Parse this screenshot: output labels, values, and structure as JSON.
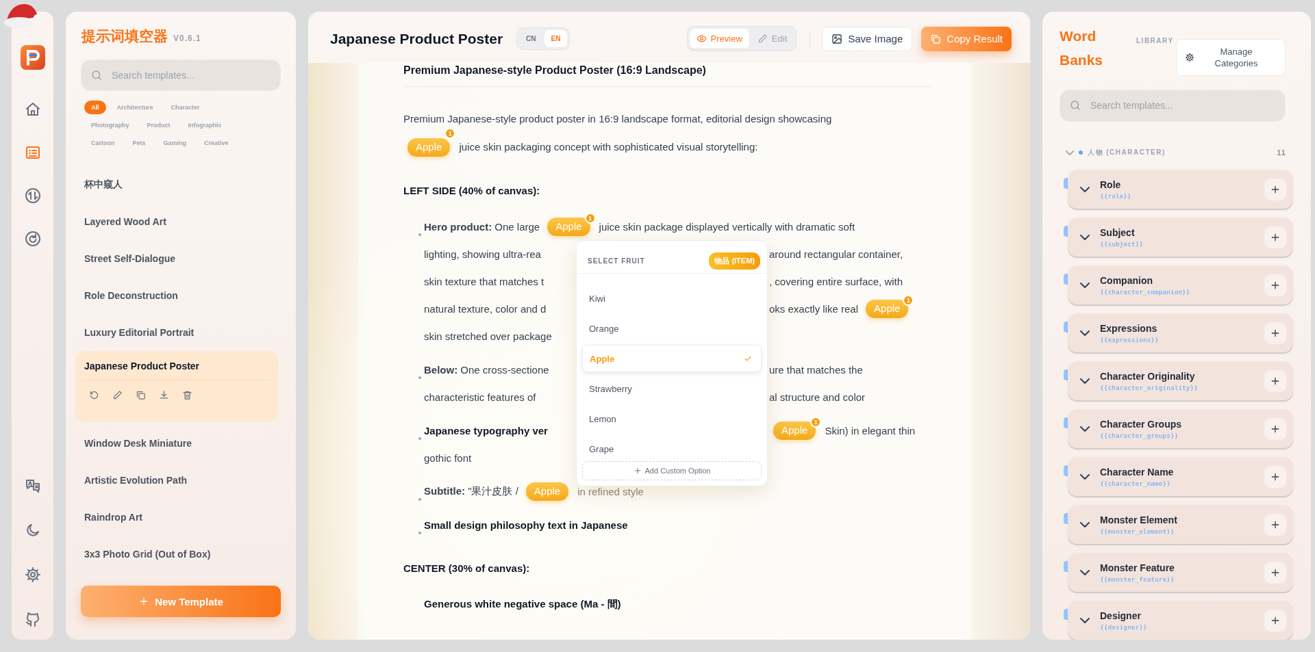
{
  "rail": {
    "items": [
      {
        "selected": false
      },
      {
        "selected": true
      },
      {
        "selected": false
      },
      {
        "selected": false
      }
    ]
  },
  "templates_panel": {
    "brand": "提示词填空器",
    "version": "V0.6.1",
    "search": {
      "placeholder": "Search templates..."
    },
    "filters": [
      {
        "label": "All",
        "selected": true
      },
      {
        "label": "Architecture",
        "selected": false
      },
      {
        "label": "Character",
        "selected": false
      },
      {
        "label": "Photography",
        "selected": false
      },
      {
        "label": "Product",
        "selected": false
      },
      {
        "label": "Infographic",
        "selected": false
      },
      {
        "label": "Cartoon",
        "selected": false
      },
      {
        "label": "Pets",
        "selected": false
      },
      {
        "label": "Gaming",
        "selected": false
      },
      {
        "label": "Creative",
        "selected": false
      }
    ],
    "templates": [
      {
        "title": "杯中窥人",
        "selected": false
      },
      {
        "title": "Layered Wood Art",
        "selected": false
      },
      {
        "title": "Street Self-Dialogue",
        "selected": false
      },
      {
        "title": "Role Deconstruction",
        "selected": false
      },
      {
        "title": "Luxury Editorial Portrait",
        "selected": false
      },
      {
        "title": "Japanese Product Poster",
        "selected": true
      },
      {
        "title": "Window Desk Miniature",
        "selected": false
      },
      {
        "title": "Artistic Evolution Path",
        "selected": false
      },
      {
        "title": "Raindrop Art",
        "selected": false
      },
      {
        "title": "3x3 Photo Grid (Out of Box)",
        "selected": false
      }
    ],
    "new_template": "New Template"
  },
  "editor": {
    "title": "Japanese Product Poster",
    "language": [
      {
        "label": "CN",
        "selected": false
      },
      {
        "label": "EN",
        "selected": true
      }
    ],
    "view": [
      {
        "label": "Preview",
        "selected": true
      },
      {
        "label": "Edit",
        "selected": false
      }
    ],
    "actions": [
      {
        "label": "Save Image",
        "kind": "secondary"
      },
      {
        "label": "Copy Result",
        "kind": "primary"
      }
    ],
    "blocks": [
      {
        "kind": "title",
        "text": "Premium Japanese-style Product Poster (16:9 Landscape)"
      },
      {
        "kind": "paragraph",
        "segments": [
          {
            "kind": "text",
            "text": "Premium Japanese-style product poster in 16:9 landscape format, editorial design showcasing"
          },
          {
            "kind": "chip",
            "text": "Apple",
            "badge": "1"
          },
          {
            "kind": "text",
            "text": "juice skin packaging concept with sophisticated visual storytelling:"
          }
        ]
      },
      {
        "kind": "heading",
        "text": "LEFT SIDE (40% of canvas):"
      },
      {
        "kind": "lines",
        "lines": [
          {
            "bullet": true,
            "full": [
              {
                "kind": "text",
                "text": "**Hero product:** One large"
              },
              {
                "kind": "chip",
                "text": "Apple",
                "badge": "1"
              },
              {
                "kind": "text",
                "text": "juice skin package displayed vertically with dramatic soft"
              }
            ]
          },
          {
            "bullet": false,
            "left": [
              {
                "kind": "text",
                "text": "lighting, showing ultra-rea"
              }
            ],
            "right": [
              {
                "kind": "text",
                "text": "around rectangular container,"
              }
            ]
          },
          {
            "bullet": false,
            "left": [
              {
                "kind": "text",
                "text": "skin texture that matches t"
              }
            ],
            "right": [
              {
                "kind": "text",
                "text": ", covering entire surface, with"
              }
            ]
          },
          {
            "bullet": false,
            "left": [
              {
                "kind": "text",
                "text": "natural texture, color and d"
              }
            ],
            "right": [
              {
                "kind": "text",
                "text": "oks exactly like real"
              },
              {
                "kind": "chip",
                "text": "Apple",
                "badge": "1"
              }
            ]
          },
          {
            "bullet": false,
            "left": [
              {
                "kind": "text",
                "text": "skin stretched over package"
              }
            ]
          },
          {
            "bullet": true,
            "left": [
              {
                "kind": "text",
                "text": "**Below:** One cross-sectione"
              }
            ],
            "right": [
              {
                "kind": "text",
                "text": "ure that matches the"
              }
            ]
          },
          {
            "bullet": false,
            "left": [
              {
                "kind": "text",
                "text": "characteristic features of"
              }
            ],
            "right": [
              {
                "kind": "text",
                "text": "al structure and color"
              }
            ]
          },
          {
            "bullet": true,
            "left": [
              {
                "kind": "strong",
                "text": "Japanese typography ver"
              }
            ],
            "right": [
              {
                "kind": "chip",
                "text": "Apple",
                "badge": "1"
              },
              {
                "kind": "text",
                "text": "Skin) in elegant thin"
              }
            ]
          },
          {
            "bullet": false,
            "left": [
              {
                "kind": "text",
                "text": "gothic font"
              }
            ]
          },
          {
            "bullet": true,
            "full": [
              {
                "kind": "text",
                "text": "**Subtitle:** \"果汁皮肤 /"
              },
              {
                "kind": "chip",
                "text": "Apple"
              },
              {
                "kind": "faint",
                "text": "in refined style"
              }
            ]
          },
          {
            "bullet": true,
            "full": [
              {
                "kind": "strong",
                "text": "Small design philosophy text in Japanese"
              }
            ]
          }
        ],
        "dropdown": {
          "title": "SELECT FRUIT",
          "tag": "物品 (ITEM)",
          "options": [
            {
              "label": "Kiwi",
              "selected": false
            },
            {
              "label": "Orange",
              "selected": false
            },
            {
              "label": "Apple",
              "selected": true
            },
            {
              "label": "Strawberry",
              "selected": false
            },
            {
              "label": "Lemon",
              "selected": false
            },
            {
              "label": "Grape",
              "selected": false
            }
          ],
          "add_label": "Add Custom Option"
        }
      },
      {
        "kind": "heading",
        "text": "CENTER (30% of canvas):"
      },
      {
        "kind": "lines",
        "lines": [
          {
            "bullet": false,
            "full": [
              {
                "kind": "strong",
                "text": "Generous white negative space (Ma - 間)"
              }
            ]
          }
        ]
      }
    ]
  },
  "word_banks": {
    "title": "Word Banks",
    "library_label": "LIBRARY",
    "manage": "Manage Categories",
    "search": {
      "placeholder": "Search templates..."
    },
    "category": {
      "name": "人物 (CHARACTER)",
      "count": "11",
      "expanded": true
    },
    "banks": [
      {
        "name": "Role",
        "key": "{{role}}"
      },
      {
        "name": "Subject",
        "key": "{{subject}}"
      },
      {
        "name": "Companion",
        "key": "{{character_companion}}"
      },
      {
        "name": "Expressions",
        "key": "{{expressions}}"
      },
      {
        "name": "Character Originality",
        "key": "{{character_originality}}"
      },
      {
        "name": "Character Groups",
        "key": "{{character_groups}}"
      },
      {
        "name": "Character Name",
        "key": "{{character_name}}"
      },
      {
        "name": "Monster Element",
        "key": "{{monster_element}}"
      },
      {
        "name": "Monster Feature",
        "key": "{{monster_feature}}"
      },
      {
        "name": "Designer",
        "key": "{{designer}}"
      }
    ]
  }
}
